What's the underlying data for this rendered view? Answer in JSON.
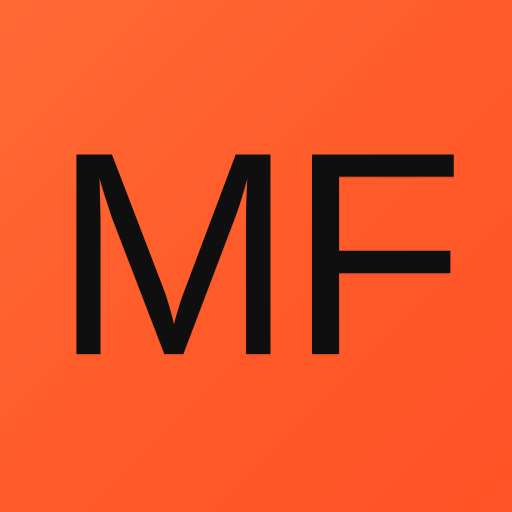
{
  "tile": {
    "monogram": "MF",
    "background_color": "#ff5a2a",
    "text_color": "#0f0f0f"
  }
}
